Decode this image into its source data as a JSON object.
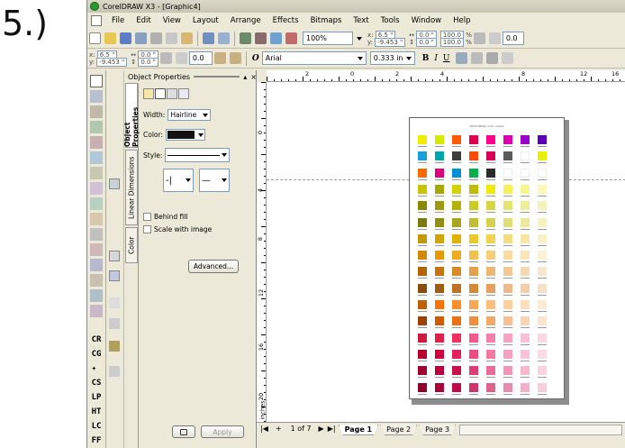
{
  "annotation": {
    "step": "5.)"
  },
  "window": {
    "title": "CorelDRAW X3 - [Graphic4]"
  },
  "menu": [
    "File",
    "Edit",
    "View",
    "Layout",
    "Arrange",
    "Effects",
    "Bitmaps",
    "Text",
    "Tools",
    "Window",
    "Help"
  ],
  "standard_toolbar": {
    "zoom": "100%",
    "x": "6.5 \"",
    "y": "-9.453 \"",
    "w": "0.0 \"",
    "h": "0.0 \"",
    "scale_w": "100.0",
    "scale_h": "100.0",
    "pct": "%",
    "rotation": "0.0"
  },
  "property_bar": {
    "x": "6.5 \"",
    "y": "-9.453 \"",
    "w": "0.0 \"",
    "h": "0.0 \"",
    "rotation": "0.0",
    "font": "Arial",
    "font_size": "0.333 in"
  },
  "docker": {
    "title": "Object Properties",
    "tabs": [
      "Object Properties",
      "Linear Dimensions",
      "Color"
    ],
    "width_label": "Width:",
    "width_value": "Hairline",
    "color_label": "Color:",
    "style_label": "Style:",
    "behind_fill": "Behind fill",
    "scale_with_image": "Scale with image",
    "advanced": "Advanced...",
    "apply": "Apply"
  },
  "left_tools": {
    "labels": [
      "CR",
      "CG",
      "CS",
      "LP",
      "HT",
      "LC",
      "FF"
    ]
  },
  "hruler": {
    "ticks": [
      "2",
      "0",
      "2",
      "4",
      "8",
      "12",
      "16"
    ]
  },
  "vruler": {
    "ticks": [
      "0",
      "4",
      "8",
      "12",
      "16",
      "20"
    ],
    "unit": "inches"
  },
  "page": {
    "title": "PANTONE(R) solid coated"
  },
  "pages": {
    "counter": "1 of 7",
    "tabs": [
      "Page 1",
      "Page 2",
      "Page 3"
    ]
  },
  "colors": {
    "rows": [
      [
        "#f0ec00",
        "#d6ea00",
        "#ff5a00",
        "#e0004f",
        "#ff0090",
        "#dd00b3",
        "#9a00c8",
        "#5b00b8"
      ],
      [
        "#1b9fd8",
        "#00a4ad",
        "#3e3e3e",
        "#ff4b00",
        "#d90058",
        "#5a5a5a",
        "#ffffff",
        "#e8f200"
      ],
      [
        "#ff6a00",
        "#e0007a",
        "#0090d8",
        "#00b04a",
        "#2b2b2b",
        "#ffffff",
        "#ffffff",
        "#ffffff"
      ],
      [
        "#c8c400",
        "#a6a800",
        "#d4d200",
        "#bebc00",
        "#eeea00",
        "#f4f258",
        "#f8f690",
        "#fbf9b8"
      ],
      [
        "#8a8700",
        "#9c9a10",
        "#b5b300",
        "#cccc20",
        "#d8d640",
        "#e6e470",
        "#efee98",
        "#f4f3bc"
      ],
      [
        "#7b7a10",
        "#908e14",
        "#a8a620",
        "#c0be34",
        "#d4d250",
        "#e0de78",
        "#ebea9c",
        "#f3f2c0"
      ],
      [
        "#c49800",
        "#d2a400",
        "#e0b400",
        "#eac82a",
        "#f2d250",
        "#f5dc7c",
        "#f7e7a4",
        "#faf0c8"
      ],
      [
        "#d28800",
        "#e49a00",
        "#f0ac20",
        "#f6c050",
        "#f8cf78",
        "#fadca0",
        "#fbe6bc",
        "#fdf0d8"
      ],
      [
        "#b56200",
        "#c87410",
        "#d88a28",
        "#e6a048",
        "#eeb670",
        "#f2c894",
        "#f6d8b4",
        "#f9e6d0"
      ],
      [
        "#8a4c00",
        "#a05c10",
        "#c07020",
        "#d68838",
        "#e6a060",
        "#eeb888",
        "#f3ceaa",
        "#f8e0c8"
      ],
      [
        "#c06000",
        "#ff7400",
        "#ff8e28",
        "#ffa650",
        "#ffbe7a",
        "#ffcf9c",
        "#ffdebc",
        "#ffead6"
      ],
      [
        "#a04000",
        "#d05a00",
        "#ee7010",
        "#f28e40",
        "#f5a868",
        "#f8c094",
        "#fad4b4",
        "#fce4d0"
      ],
      [
        "#d01840",
        "#e2204c",
        "#f03060",
        "#f6588a",
        "#f880a8",
        "#faa2c0",
        "#fcc0d4",
        "#fdd8e4"
      ],
      [
        "#b80030",
        "#ce0040",
        "#e2205c",
        "#ee4c80",
        "#f47aa0",
        "#f8a0bc",
        "#fac2d4",
        "#fcdae6"
      ],
      [
        "#a00030",
        "#b80040",
        "#c8104c",
        "#de3c74",
        "#ea6c98",
        "#f296b6",
        "#f7b8ce",
        "#fad2e0"
      ],
      [
        "#90002c",
        "#a80038",
        "#be0a48",
        "#d03468",
        "#e2608c",
        "#ec8aae",
        "#f4b0c8",
        "#f8cedd"
      ]
    ]
  }
}
